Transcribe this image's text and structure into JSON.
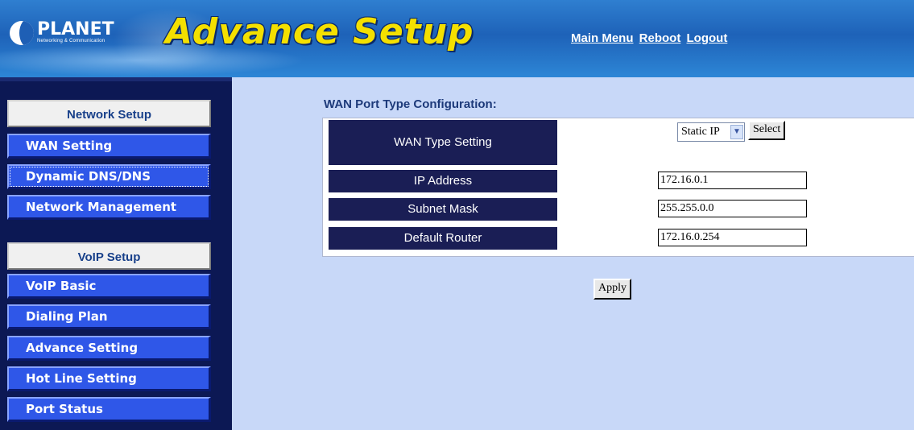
{
  "header": {
    "logo_text": "PLANET",
    "logo_sub": "Networking & Communication",
    "title": "Advance Setup",
    "links": [
      "Main Menu",
      "Reboot",
      "Logout"
    ]
  },
  "sidebar": {
    "network_head": "Network Setup",
    "network_items": [
      "WAN Setting",
      "Dynamic DNS/DNS",
      "Network Management"
    ],
    "voip_head": "VoIP Setup",
    "voip_items": [
      "VoIP Basic",
      "Dialing Plan",
      "Advance Setting",
      "Hot Line Setting",
      "Port Status"
    ]
  },
  "main": {
    "section_title": "WAN Port Type Configuration:",
    "wan_type_label": "WAN Type Setting",
    "wan_type_value": "Static IP",
    "select_button": "Select",
    "ip_label": "IP Address",
    "ip_value": "172.16.0.1",
    "mask_label": "Subnet Mask",
    "mask_value": "255.255.0.0",
    "router_label": "Default Router",
    "router_value": "172.16.0.254",
    "apply_button": "Apply"
  },
  "colors": {
    "header_blue": "#1e62b8",
    "title_yellow": "#f4e000",
    "sidebar_navy": "#0c1854",
    "nav_blue": "#2f57e8",
    "content_bg": "#c8d8f8",
    "label_cell": "#1a1e55"
  }
}
